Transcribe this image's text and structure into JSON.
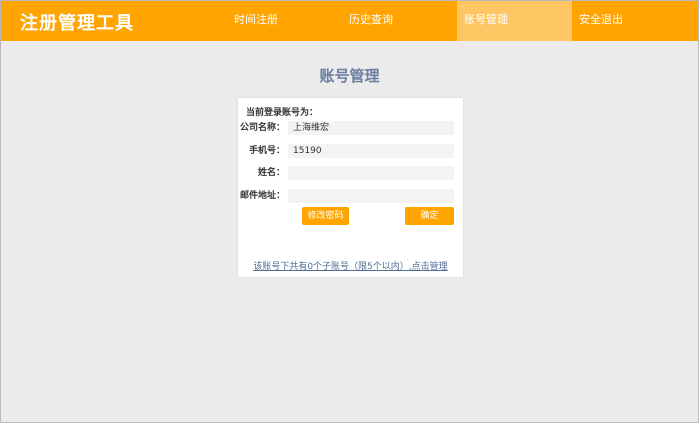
{
  "header": {
    "logo": "注册管理工具",
    "nav": [
      {
        "label": "时间注册"
      },
      {
        "label": "历史查询"
      },
      {
        "label": "账号管理"
      },
      {
        "label": "安全退出"
      }
    ],
    "active_index": 2,
    "colors": {
      "bar": "#ffa400",
      "active": "#ffc664"
    }
  },
  "main": {
    "title": "账号管理",
    "current_account_label": "当前登录账号为：",
    "fields": [
      {
        "label": "公司名称：",
        "value": "上海维宏"
      },
      {
        "label": "手机号：",
        "value": "15190"
      },
      {
        "label": "姓名：",
        "value": ""
      },
      {
        "label": "邮件地址：",
        "value": ""
      }
    ],
    "change_password_button": "修改密码",
    "confirm_button": "确定",
    "footer_link": "该账号下共有0个子账号（限5个以内）,点击管理"
  }
}
